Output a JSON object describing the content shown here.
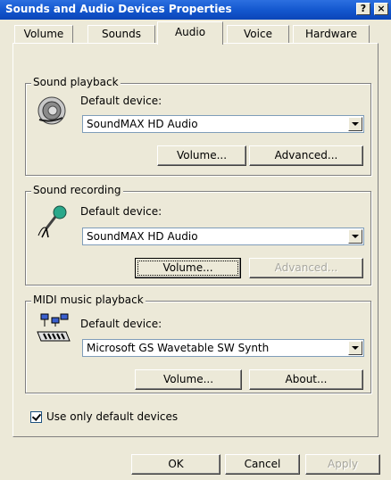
{
  "window": {
    "title": "Sounds and Audio Devices Properties",
    "help_glyph": "?",
    "close_glyph": "×"
  },
  "tabs": [
    {
      "label": "Volume"
    },
    {
      "label": "Sounds"
    },
    {
      "label": "Audio"
    },
    {
      "label": "Voice"
    },
    {
      "label": "Hardware"
    }
  ],
  "playback": {
    "title": "Sound playback",
    "label": "Default device:",
    "device": "SoundMAX HD Audio",
    "volume_label": "Volume...",
    "advanced_label": "Advanced..."
  },
  "recording": {
    "title": "Sound recording",
    "label": "Default device:",
    "device": "SoundMAX HD Audio",
    "volume_label": "Volume...",
    "advanced_label": "Advanced..."
  },
  "midi": {
    "title": "MIDI music playback",
    "label": "Default device:",
    "device": "Microsoft GS Wavetable SW Synth",
    "volume_label": "Volume...",
    "about_label": "About..."
  },
  "checkbox": {
    "label": "Use only default devices",
    "checked": true
  },
  "footer": {
    "ok_label": "OK",
    "cancel_label": "Cancel",
    "apply_label": "Apply"
  }
}
